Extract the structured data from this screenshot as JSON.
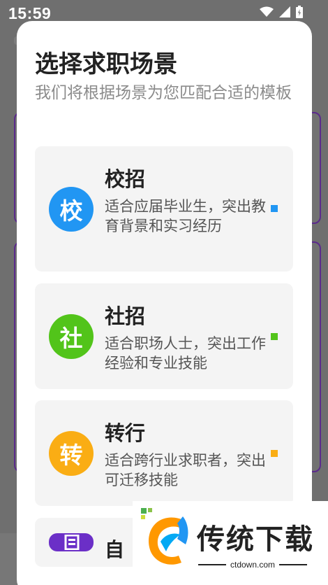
{
  "status_bar": {
    "time": "15:59"
  },
  "dialog": {
    "title": "选择求职场景",
    "subtitle": "我们将根据场景为您匹配合适的模板",
    "options": [
      {
        "badge": "校",
        "title": "校招",
        "description": "适合应届毕业生，突出教育背景和实习经历",
        "color": "#2196F3"
      },
      {
        "badge": "社",
        "title": "社招",
        "description": "适合职场人士，突出工作经验和专业技能",
        "color": "#52C41A"
      },
      {
        "badge": "转",
        "title": "转行",
        "description": "适合跨行业求职者，突出可迁移技能",
        "color": "#FAAD14"
      }
    ],
    "partial_option": {
      "title": "自",
      "color": "#6B2FC7"
    }
  },
  "watermark": {
    "name": "传统下载",
    "url": "ctdown.com"
  }
}
